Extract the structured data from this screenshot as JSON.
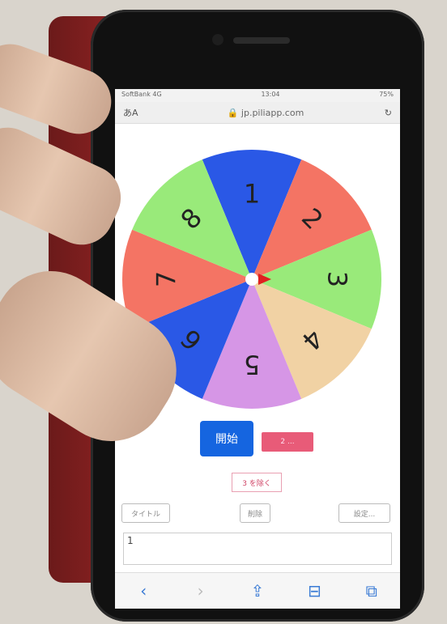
{
  "status_bar": {
    "carrier": "SoftBank 4G",
    "time": "13:04",
    "battery": "75%"
  },
  "browser": {
    "text_size": "あA",
    "url": "jp.piliapp.com",
    "reload_icon": "reload-icon"
  },
  "wheel": {
    "segments": [
      {
        "label": "1",
        "color": "#2a58e6"
      },
      {
        "label": "2",
        "color": "#f47464"
      },
      {
        "label": "3",
        "color": "#99ea7a"
      },
      {
        "label": "4",
        "color": "#f1d2a4"
      },
      {
        "label": "5",
        "color": "#d696e6"
      },
      {
        "label": "6",
        "color": "#2a58e6"
      },
      {
        "label": "7",
        "color": "#f47464"
      },
      {
        "label": "8",
        "color": "#99ea7a"
      }
    ],
    "pointer_color": "#e02020"
  },
  "controls": {
    "start_label": "開始",
    "skip_label": "2 ...",
    "remaining_label": "3 を除く"
  },
  "bottom_buttons": {
    "title_label": "タイトル",
    "delete_label": "削除",
    "setting_label": "設定..."
  },
  "list_text": "1",
  "toolbar": {
    "back": "‹",
    "forward": "›",
    "share": "⇪",
    "bookmarks": "⊟",
    "tabs": "⧉"
  }
}
